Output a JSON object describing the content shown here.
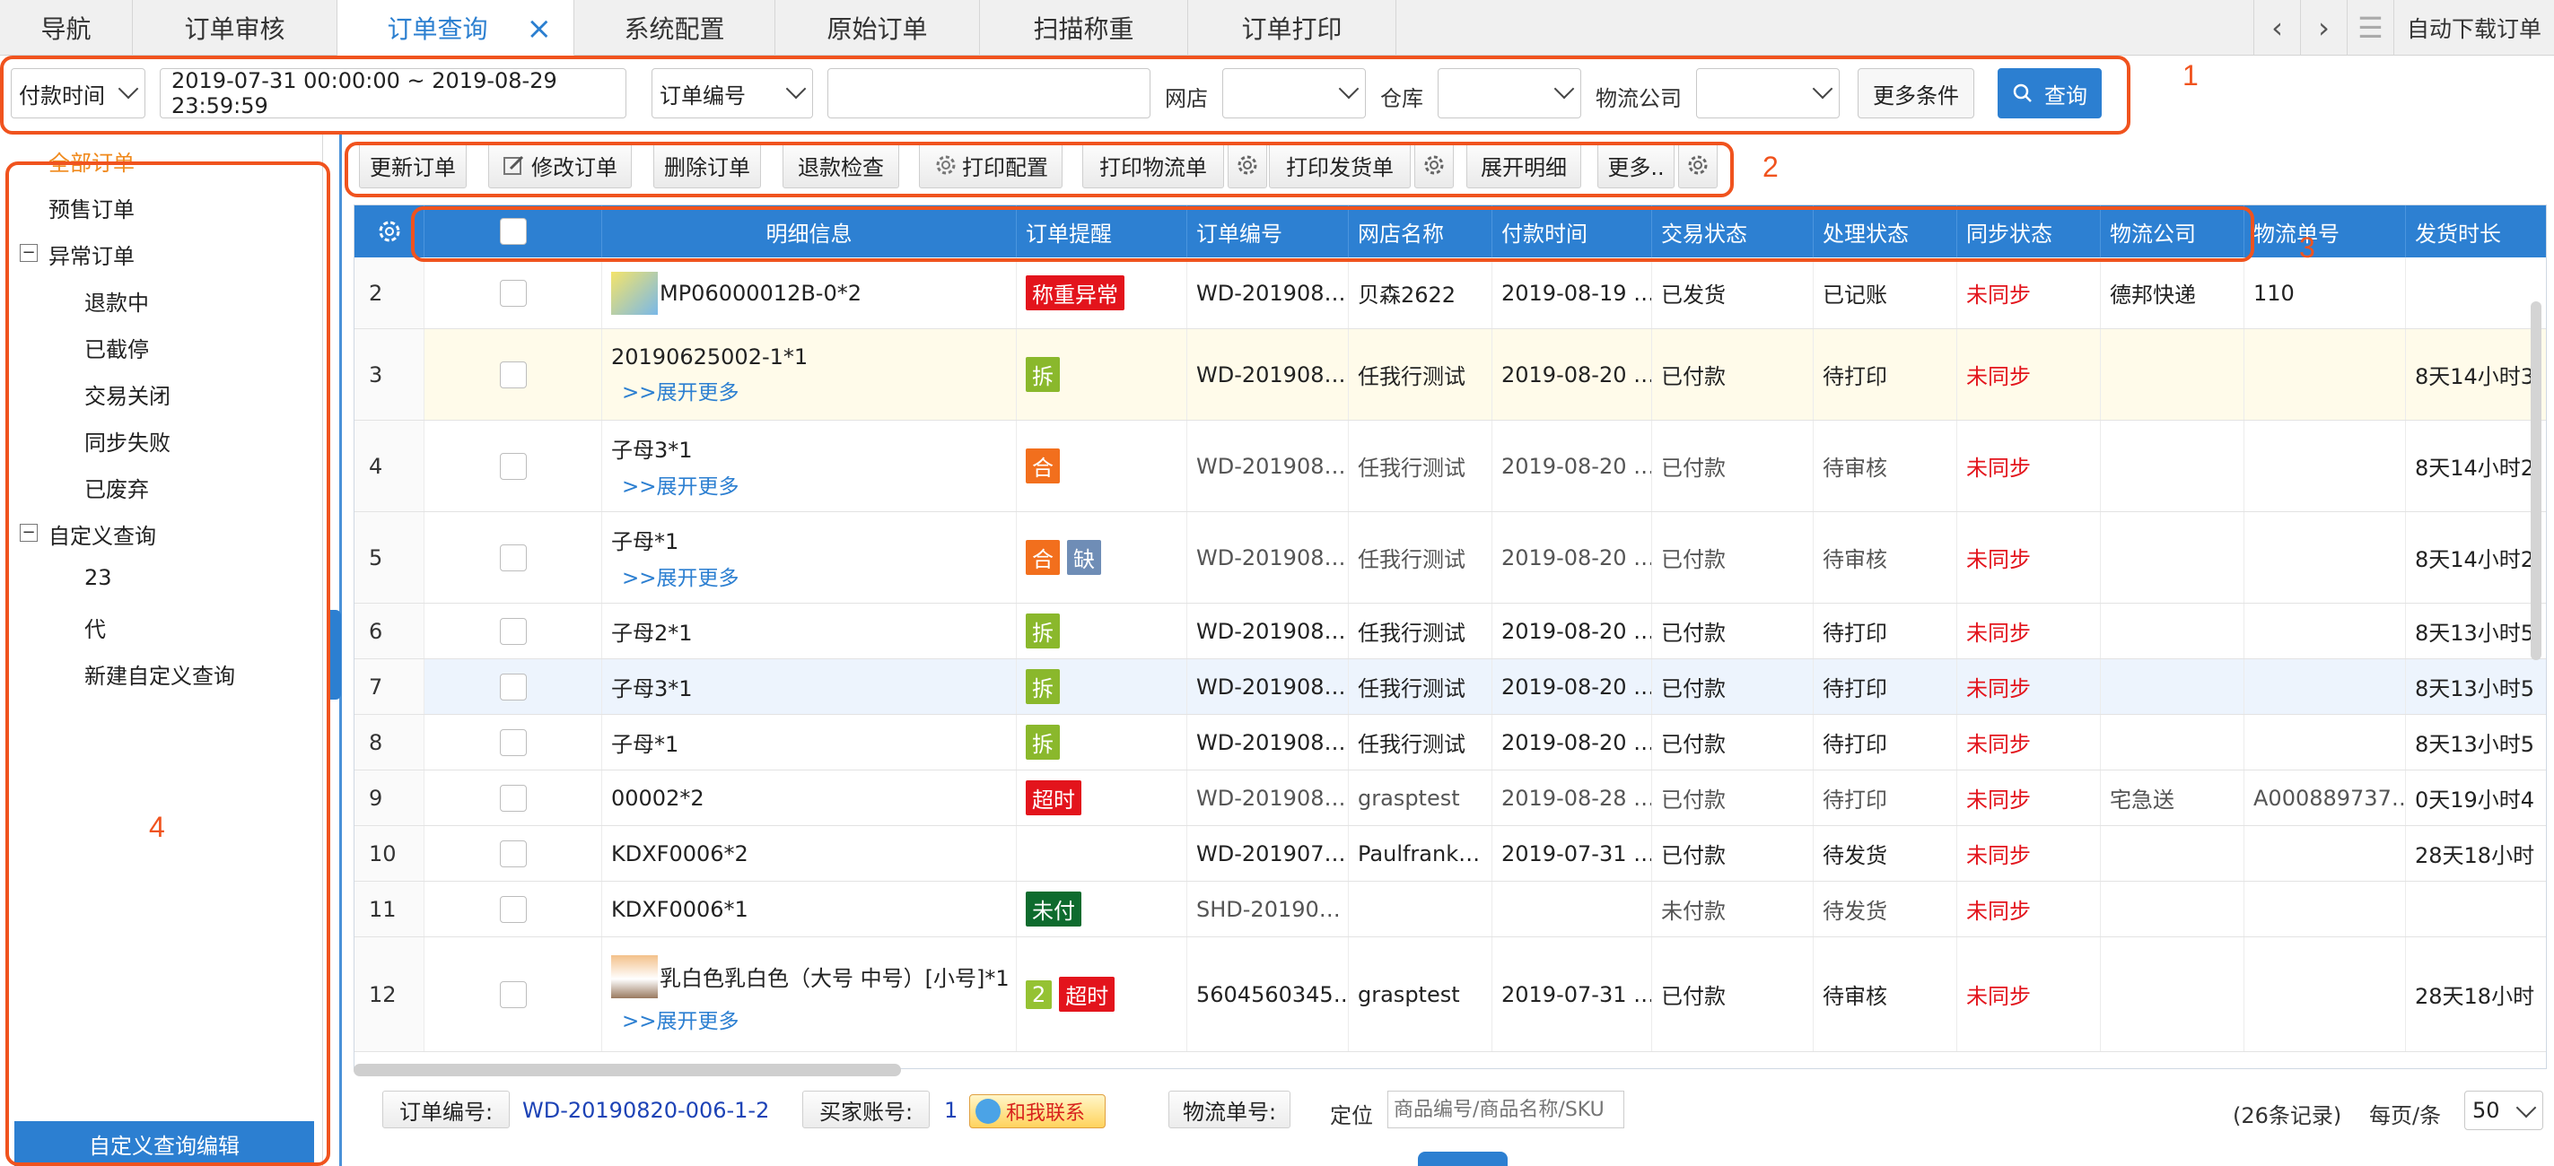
{
  "tabs": [
    {
      "label": "导航"
    },
    {
      "label": "订单审核"
    },
    {
      "label": "订单查询",
      "active": true
    },
    {
      "label": "系统配置"
    },
    {
      "label": "原始订单"
    },
    {
      "label": "扫描称重"
    },
    {
      "label": "订单打印"
    }
  ],
  "tab_close_glyph": "×",
  "tab_tools": {
    "prev": "‹",
    "next": "›",
    "menu": "☰",
    "auto_download": "自动下载订单"
  },
  "filters": {
    "time_type": "付款时间",
    "date_range": "2019-07-31 00:00:00 ~ 2019-08-29 23:59:59",
    "field_type": "订单编号",
    "field_value": "",
    "shop_label": "网店",
    "shop_value": "",
    "warehouse_label": "仓库",
    "warehouse_value": "",
    "logistics_label": "物流公司",
    "logistics_value": "",
    "more_conditions": "更多条件",
    "search": "查询"
  },
  "toolbar": {
    "update_order": "更新订单",
    "modify_order": "修改订单",
    "delete_order": "删除订单",
    "refund_check": "退款检查",
    "print_config": "打印配置",
    "print_logistics": "打印物流单",
    "print_invoice": "打印发货单",
    "expand_detail": "展开明细",
    "more": "更多.."
  },
  "sidebar": {
    "all_orders": "全部订单",
    "presale": "预售订单",
    "abnormal": "异常订单",
    "abnormal_items": [
      "退款中",
      "已截停",
      "交易关闭",
      "同步失败",
      "已废弃"
    ],
    "custom": "自定义查询",
    "custom_items": [
      "23",
      "代",
      "新建自定义查询"
    ],
    "edit_custom": "自定义查询编辑",
    "toggle_glyph": "−"
  },
  "table": {
    "columns": [
      "明细信息",
      "订单提醒",
      "订单编号",
      "网店名称",
      "付款时间",
      "交易状态",
      "处理状态",
      "同步状态",
      "物流公司",
      "物流单号",
      "发货时长"
    ],
    "expand_label": ">>展开更多",
    "rows": [
      {
        "idx": "2",
        "detail": "MP06000012B-0*2",
        "tags": [
          {
            "text": "称重异常",
            "color": "red"
          }
        ],
        "order_no": "WD-201908…",
        "shop": "贝森2622",
        "pay_time": "2019-08-19 …",
        "trade": "已发货",
        "process": "已记账",
        "sync": "未同步",
        "logistics": "德邦快递",
        "tracking": "110",
        "duration": ""
      },
      {
        "idx": "3",
        "detail": "20190625002-1*1",
        "expand": true,
        "tags": [
          {
            "text": "拆",
            "color": "green"
          }
        ],
        "order_no": "WD-201908…",
        "shop": "任我行测试",
        "pay_time": "2019-08-20 …",
        "trade": "已付款",
        "process": "待打印",
        "sync": "未同步",
        "logistics": "",
        "tracking": "",
        "duration": "8天14小时3"
      },
      {
        "idx": "4",
        "detail": "子母3*1",
        "expand": true,
        "tags": [
          {
            "text": "合",
            "color": "orange"
          }
        ],
        "order_no": "WD-201908…",
        "shop": "任我行测试",
        "pay_time": "2019-08-20 …",
        "trade": "已付款",
        "process": "待审核",
        "sync": "未同步",
        "logistics": "",
        "tracking": "",
        "duration": "8天14小时2"
      },
      {
        "idx": "5",
        "detail": "子母*1",
        "expand": true,
        "tags": [
          {
            "text": "合",
            "color": "orange"
          },
          {
            "text": "缺",
            "color": "blue"
          }
        ],
        "order_no": "WD-201908…",
        "shop": "任我行测试",
        "pay_time": "2019-08-20 …",
        "trade": "已付款",
        "process": "待审核",
        "sync": "未同步",
        "logistics": "",
        "tracking": "",
        "duration": "8天14小时2"
      },
      {
        "idx": "6",
        "detail": "子母2*1",
        "tags": [
          {
            "text": "拆",
            "color": "green"
          }
        ],
        "order_no": "WD-201908…",
        "shop": "任我行测试",
        "pay_time": "2019-08-20 …",
        "trade": "已付款",
        "process": "待打印",
        "sync": "未同步",
        "logistics": "",
        "tracking": "",
        "duration": "8天13小时5"
      },
      {
        "idx": "7",
        "detail": "子母3*1",
        "tags": [
          {
            "text": "拆",
            "color": "green"
          }
        ],
        "order_no": "WD-201908…",
        "shop": "任我行测试",
        "pay_time": "2019-08-20 …",
        "trade": "已付款",
        "process": "待打印",
        "sync": "未同步",
        "logistics": "",
        "tracking": "",
        "duration": "8天13小时5"
      },
      {
        "idx": "8",
        "detail": "子母*1",
        "tags": [
          {
            "text": "拆",
            "color": "green"
          }
        ],
        "order_no": "WD-201908…",
        "shop": "任我行测试",
        "pay_time": "2019-08-20 …",
        "trade": "已付款",
        "process": "待打印",
        "sync": "未同步",
        "logistics": "",
        "tracking": "",
        "duration": "8天13小时5"
      },
      {
        "idx": "9",
        "detail": "00002*2",
        "tags": [
          {
            "text": "超时",
            "color": "red"
          }
        ],
        "order_no": "WD-201908…",
        "shop": "grasptest",
        "pay_time": "2019-08-28 …",
        "trade": "已付款",
        "process": "待打印",
        "sync": "未同步",
        "logistics": "宅急送",
        "tracking": "A000889737…",
        "duration": "0天19小时4"
      },
      {
        "idx": "10",
        "detail": "KDXF0006*2",
        "tags": [],
        "order_no": "WD-201907…",
        "shop": "Paulfrank…",
        "pay_time": "2019-07-31 …",
        "trade": "已付款",
        "process": "待发货",
        "sync": "未同步",
        "logistics": "",
        "tracking": "",
        "duration": "28天18小时"
      },
      {
        "idx": "11",
        "detail": "KDXF0006*1",
        "tags": [
          {
            "text": "未付",
            "color": "dkgreen"
          }
        ],
        "order_no": "SHD-20190…",
        "shop": "",
        "pay_time": "",
        "trade": "未付款",
        "process": "待发货",
        "sync": "未同步",
        "logistics": "",
        "tracking": "",
        "duration": ""
      },
      {
        "idx": "12",
        "detail": "乳白色乳白色（大号 中号）[小号]*1",
        "expand": true,
        "thumb": true,
        "tags": [
          {
            "text": "2",
            "color": "lime"
          },
          {
            "text": "超时",
            "color": "red"
          }
        ],
        "order_no": "5604560345…",
        "shop": "grasptest",
        "pay_time": "2019-07-31 …",
        "trade": "已付款",
        "process": "待审核",
        "sync": "未同步",
        "logistics": "",
        "tracking": "",
        "duration": "28天18小时"
      }
    ]
  },
  "footer": {
    "order_no_label": "订单编号:",
    "order_no_value": "WD-20190820-006-1-2",
    "buyer_label": "买家账号:",
    "buyer_value": "1",
    "contact": "和我联系",
    "tracking_label": "物流单号:",
    "locate_label": "定位",
    "locate_placeholder": "商品编号/商品名称/SKU",
    "records": "(26条记录)",
    "per_page_label": "每页/条",
    "per_page_value": "50"
  },
  "annotations": [
    "1",
    "2",
    "3",
    "4"
  ],
  "colors": {
    "accent": "#2c7fd1",
    "annotation": "#f0531e",
    "danger": "#e3141c",
    "active_side": "#f08a1d"
  }
}
